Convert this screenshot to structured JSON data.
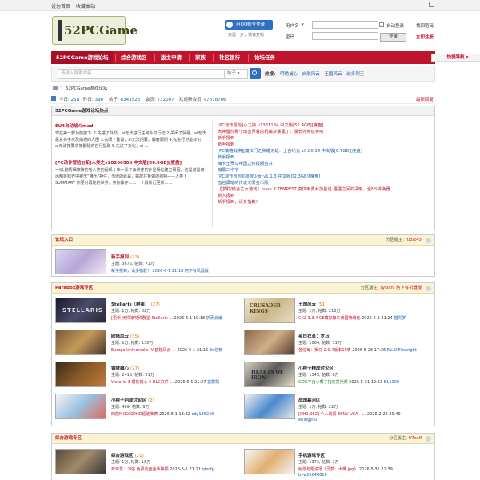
{
  "topbar": {
    "set_home": "设为首页",
    "bookmark": "收藏本站"
  },
  "logo": {
    "text": "52PCGame"
  },
  "login": {
    "qq_button": "用QQ帐号登录",
    "qq_sub": "只需一步，快速开始",
    "username_label": "用户名",
    "username_select": "▾",
    "password_label": "密码",
    "remember": "自动登录",
    "forgot": "找回密码",
    "login_button": "登录",
    "register": "立即注册"
  },
  "nav": {
    "items": [
      "52PCGame游戏论坛",
      "综合游戏区",
      "版主申请",
      "家族",
      "社区银行",
      "论坛任务"
    ],
    "quick": "快捷导航 ▾"
  },
  "search": {
    "placeholder": "请输入搜索内容",
    "type": "帖子 ▾",
    "hot_label": "热搜:",
    "hot_keywords": [
      "明绝捕心",
      "启航风云",
      "王国风云",
      "战多列王"
    ]
  },
  "breadcrumb": {
    "current": "52PCGame游戏论坛"
  },
  "stats": {
    "today_label": "今日:",
    "today": "258",
    "yesterday_label": "昨日:",
    "yesterday": "390",
    "posts_label": "帖子:",
    "posts": "8343528",
    "members_label": "会员:",
    "members": "732007",
    "welcome_label": "欢迎新会员:",
    "newest": "c7878786",
    "newest_posts": "最新回复"
  },
  "hot": {
    "heading": "52PCGame游戏论坛热点",
    "left": [
      {
        "title": "EU4自动战斗mod",
        "body": "现在第一部功能按下: 1.先进了外交，ai无法进行任何外交行动 2.关闭了贸易，ai无法恶意将手点及摆通商人团 3.关闭了建设，ai无法招募，解雇顾问 4.先进行对是标识，ai无法按要求被删除的自行提取 5.先进了文化，ai ..."
      },
      {
        "title": "[PC动作冒险][新]人类之v20260508 中文版[86.5GB][度盘]",
        "body": "一切,剧情细被破的哈人类的起现丨华一辈子去讲述的外星场站建立研因，这是游是奇风精目标界中被击“佛乐”神仔，击败的就是，掘故在鲁做的独特——人类丨 SUMMARY 你要对再能的世界，实际操作……一个最新近更新……"
      }
    ],
    "right": [
      "[PC动作冒险]心之狼 v7331134 中文版[52.4GB][度盘]",
      "大神留你那个出击界着的机械冷暴黑了：漫长外笑说笑吧",
      "新手报到",
      "新手报到",
      "[PC策略战棋][魔法门之英雄无敌：上古纪元 v0.80.14 中文版[6.7GB][度盘]",
      "新手报到",
      "梅卡士罗马帝国之终极版合并",
      "暗黑三个字",
      "[PC动作冒险][寂晓少女 v1.1.3 中文版][2.3GB][度盘]",
      "血包黑暗的传说无限金币版",
      "【求助/结合乙女游戏】even if TEMPEST 复仇甲勇女加星说 强强之间的清晰，全NS转换器",
      "新人报到",
      "新手报到，请多指教！"
    ]
  },
  "section_newbie": {
    "title": "论坛入口",
    "mod_label": "分区版主:",
    "mod_name": "fubi245",
    "forum": {
      "name": "新手报到",
      "today": "(23)",
      "counts": "主题: 3675, 帖数: 71万",
      "last": "新手报到，请多指教！ 2026-6-1 21:18 阿下有机器版"
    }
  },
  "section_paradox": {
    "title": "Paradox游戏专区",
    "mod_label": "分区版主:",
    "mod_name": "Lysian, 阿下有机器版",
    "forums": [
      {
        "name": "Stellaris（群星）",
        "today": "(27)",
        "counts": "主题: 1万, 帖数: 82万",
        "last_topic": "[更新]无情家特殊群星 Stellaris ...",
        "last_time": "2026-6-1 19:18",
        "last_user": "抓而会编"
      },
      {
        "name": "王国风云",
        "today": "(51)",
        "counts": "主题: 1万, 帖数: 218万",
        "last_topic": "CK2 3.3.4 CE模拟静亡黄国嘛增化",
        "last_time": "2026-6-1 21:24",
        "last_user": "猫青岁"
      },
      {
        "name": "欧陆风云",
        "today": "(35)",
        "counts": "主题: 1万, 帖数: 136万",
        "last_topic": "Europa Universalis IV 欧陆风云 ...",
        "last_time": "2026-6-1 21:16",
        "last_user": "3d信赖"
      },
      {
        "name": "英白衣革：罗马",
        "today": "",
        "counts": "主题: 1064, 帖数: 11万",
        "last_topic": "各位每：罗马 2.0.4版本10表",
        "last_time": "2026-5-26 17:36",
        "last_user": "Fai.D.Flowright"
      },
      {
        "name": "钢铁雄心",
        "today": "(27)",
        "counts": "主题: 2415, 帖数: 21万",
        "last_topic": "Victoria 3 钢铁雄心 3 DLC文件 ...",
        "last_time": "2026-6-1 21:27",
        "last_user": "富群赋"
      },
      {
        "name": "小程子精成讨论区",
        "today": "",
        "counts": "主题: 1345, 帖数: 6万",
        "last_topic": "GOG平台小帮子指定发光频",
        "last_time": "2026-5-31 19:53",
        "last_user": "B11000"
      },
      {
        "name": "小程子判成讨论区",
        "today": "(2)",
        "counts": "主题: 469, 帖数: 9万",
        "last_topic": "四般MOD和DHD超速准表",
        "last_time": "2026-6-1 18:32",
        "last_user": "cdy135246"
      },
      {
        "name": "战国暴河区",
        "today": "",
        "counts": "主题: 1万, 帖数: 22万",
        "last_topic": "[DH1.052] 个人战报 36NV USA - ...",
        "last_time": "2026-2-22 20:49",
        "last_user": "erlingyliu"
      }
    ]
  },
  "section_general": {
    "title": "综合游戏专区",
    "mod_label": "分区版主:",
    "mod_name": "97calf",
    "forums": [
      {
        "name": "综合游戏区",
        "today": "(21)",
        "counts": "主题: 1万, 帖数: 15万",
        "last_topic": "死可爱：习俗 免费内面金币换额",
        "last_time": "2026-6-1 21:11",
        "last_user": "qtscfy"
      },
      {
        "name": "手机游戏专区",
        "today": "",
        "counts": "主题: 1373, 帖数: 2万",
        "last_topic": "射雷与题说场《灵梦：大鹰.jpg》",
        "last_time": "2026-5-31 22:39",
        "last_user": "byw20040616"
      }
    ]
  },
  "colors": {
    "nav": "#c0142d",
    "link": "#1a5da8",
    "section_header": "#fbf4d4"
  }
}
